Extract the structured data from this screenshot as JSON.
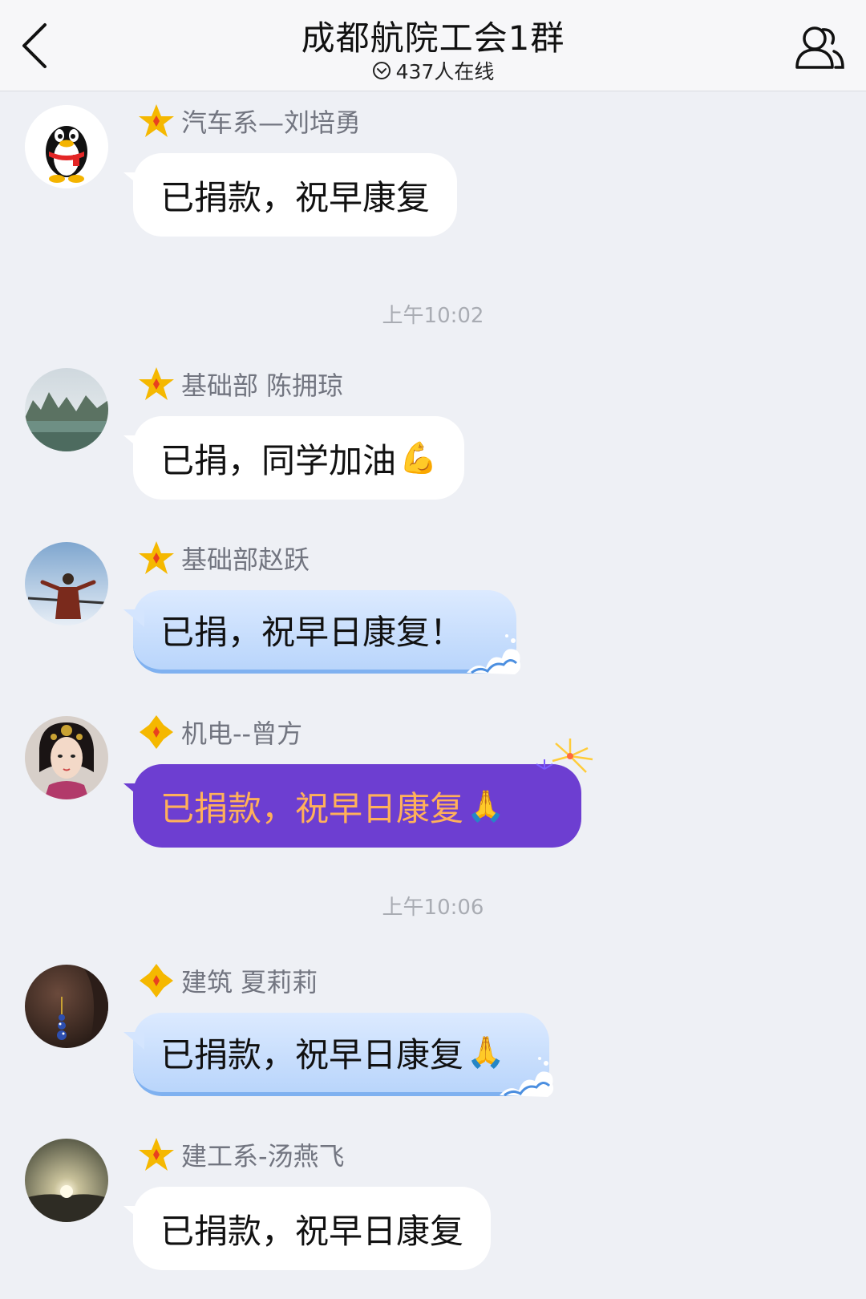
{
  "header": {
    "title": "成都航院工会1群",
    "online": "437人在线"
  },
  "chat": {
    "timestamps": [
      "上午10:02",
      "上午10:06"
    ],
    "messages": [
      {
        "sender": "汽车系—刘培勇",
        "text": "已捐款，祝早康复",
        "emoji": "",
        "bubble": "white",
        "avatar": "qq-penguin"
      },
      {
        "sender": "基础部 陈拥琼",
        "text": "已捐，同学加油",
        "emoji": "💪",
        "bubble": "white",
        "avatar": "landscape"
      },
      {
        "sender": "基础部赵跃",
        "text": "已捐，祝早日康复！",
        "emoji": "",
        "bubble": "blue-wave",
        "avatar": "person-sky"
      },
      {
        "sender": "机电--曾方",
        "text": "已捐款，祝早日康复",
        "emoji": "🙏",
        "bubble": "purple-fireworks",
        "avatar": "lady-portrait"
      },
      {
        "sender": "建筑 夏莉莉",
        "text": "已捐款，祝早日康复",
        "emoji": "🙏",
        "bubble": "blue-wave",
        "avatar": "earring"
      },
      {
        "sender": "建工系-汤燕飞",
        "text": "已捐款，祝早日康复",
        "emoji": "",
        "bubble": "white",
        "avatar": "sunrise"
      }
    ]
  },
  "icons": {
    "back": "chevron-left-icon",
    "members": "group-members-icon",
    "online": "chevron-down-circle-icon",
    "badge": "star-badge-icon"
  },
  "colors": {
    "background": "#eef0f5",
    "badge": "#f5b800",
    "purple_bubble": "#6d3ed1",
    "purple_text": "#ffb05a",
    "blue_bubble": "#c8defc"
  }
}
